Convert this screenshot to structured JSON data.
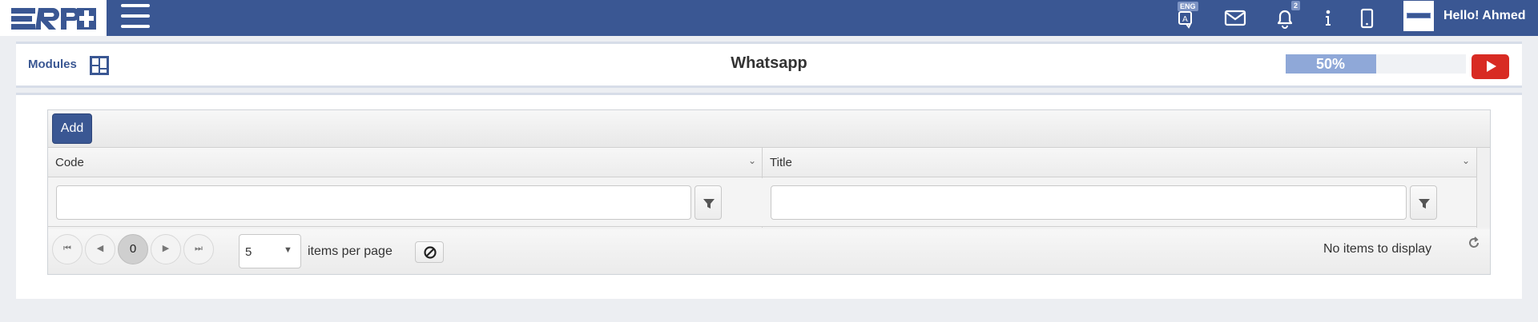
{
  "topbar": {
    "logo_text": "ERP",
    "lang_badge": "ENG",
    "notifications_count": "2",
    "greeting": "Hello! Ahmed"
  },
  "module_header": {
    "modules_label": "Modules",
    "title": "Whatsapp",
    "progress_value": 0.5,
    "progress_label": "50%"
  },
  "grid": {
    "add_label": "Add",
    "columns": [
      {
        "label": "Code"
      },
      {
        "label": "Title"
      }
    ],
    "pager": {
      "current_page": "0",
      "page_size": "5",
      "items_per_page_label": "items per page",
      "no_items_label": "No items to display"
    }
  },
  "colors": {
    "brand": "#3a5793",
    "progress_fill": "#8fa8d8",
    "youtube": "#d82b23"
  }
}
